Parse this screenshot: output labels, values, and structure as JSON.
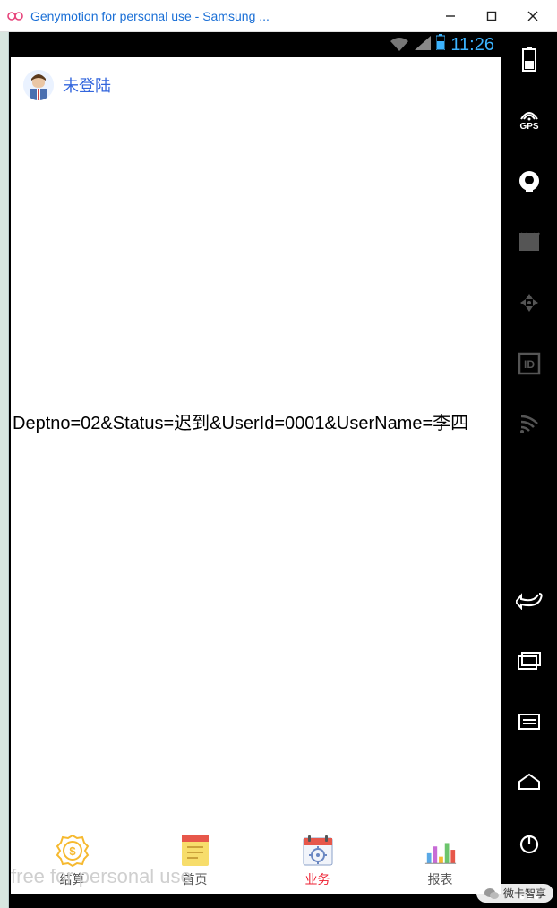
{
  "window": {
    "title": "Genymotion for personal use - Samsung ...",
    "controls": {
      "minimize": "—",
      "maximize": "▢",
      "close": "✕"
    }
  },
  "android_status": {
    "time": "11:26"
  },
  "app": {
    "user_label": "未登陆",
    "debug_text": "Deptno=02&Status=迟到&UserId=0001&UserName=李四",
    "watermark": "free for personal use"
  },
  "nav": {
    "items": [
      {
        "label": "结算",
        "icon": "coin-icon"
      },
      {
        "label": "首页",
        "icon": "book-icon"
      },
      {
        "label": "业务",
        "icon": "calendar-icon"
      },
      {
        "label": "报表",
        "icon": "chart-icon"
      }
    ],
    "active_index": 2
  },
  "geny_rail": {
    "gps": "GPS"
  },
  "wechat": {
    "label": "微卡智享"
  }
}
